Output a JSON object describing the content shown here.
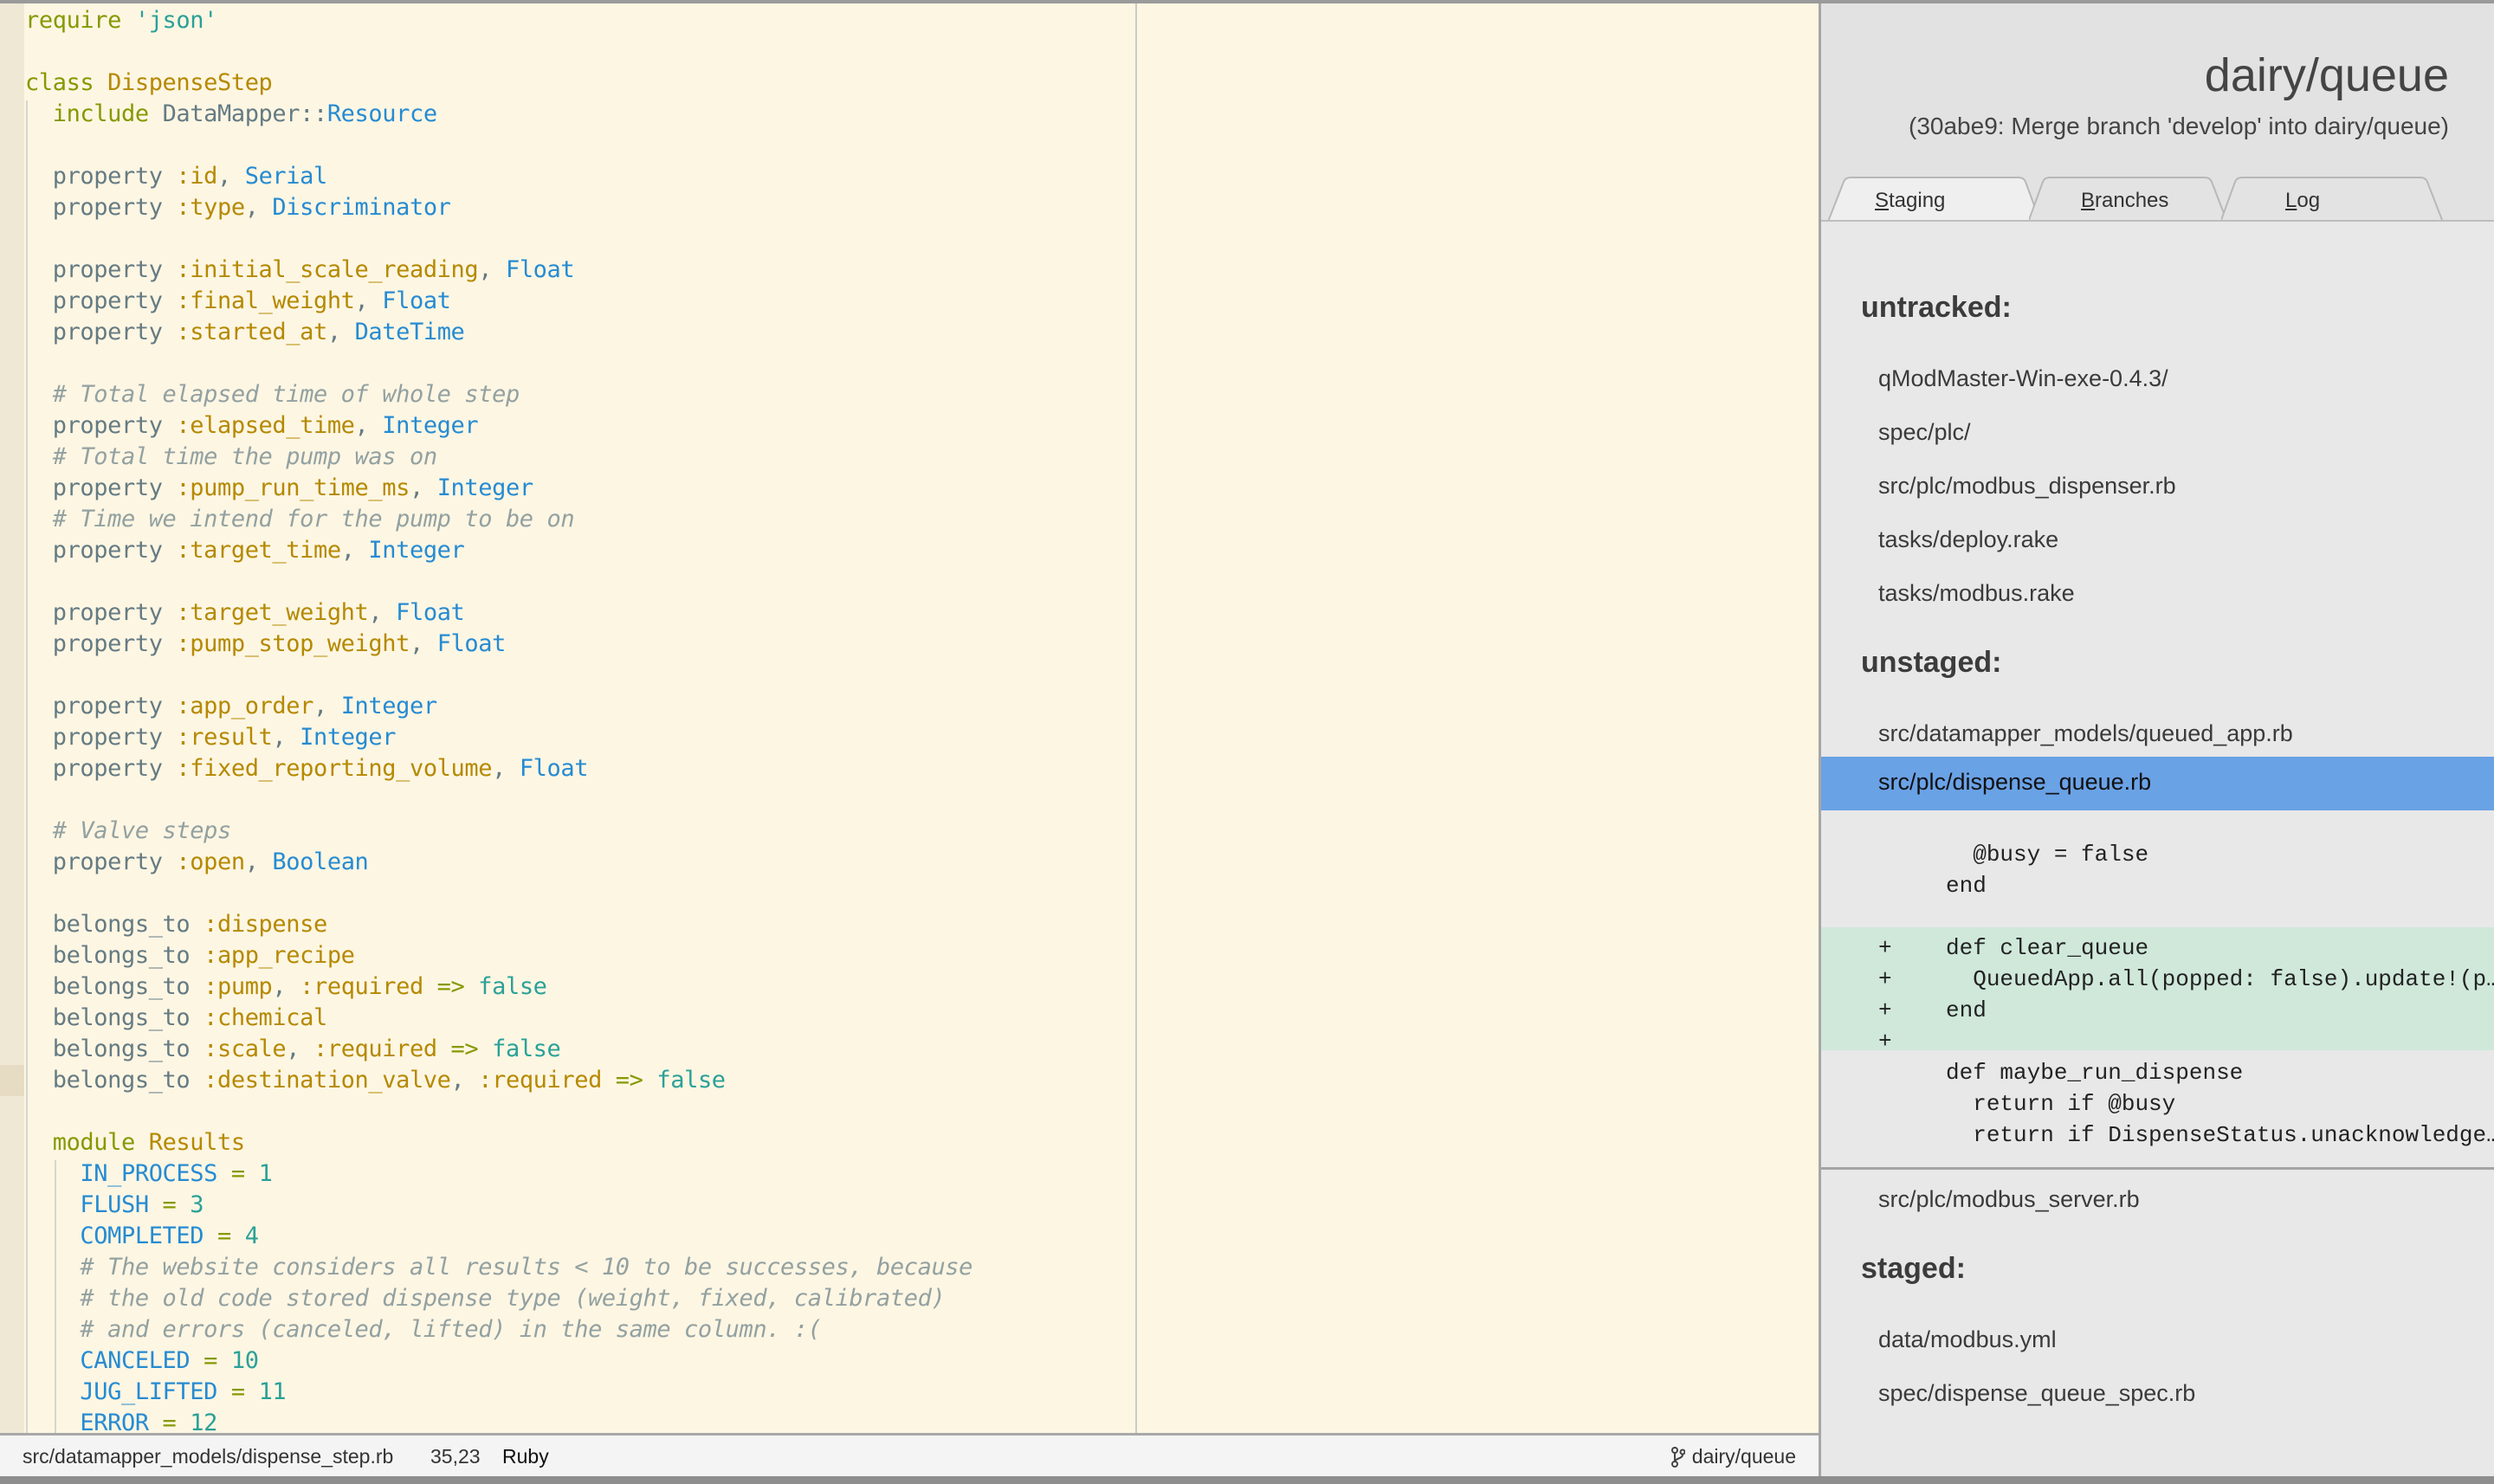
{
  "editor": {
    "lines": [
      [
        [
          "kw",
          "require "
        ],
        [
          "str",
          "'json'"
        ]
      ],
      [],
      [
        [
          "kw",
          "class "
        ],
        [
          "cls",
          "DispenseStep"
        ]
      ],
      [
        [
          "",
          "  "
        ],
        [
          "kw",
          "include "
        ],
        [
          "",
          "DataMapper::"
        ],
        [
          "const",
          "Resource"
        ]
      ],
      [],
      [
        [
          "",
          "  property "
        ],
        [
          "sym",
          ":id"
        ],
        [
          "",
          ", "
        ],
        [
          "const",
          "Serial"
        ]
      ],
      [
        [
          "",
          "  property "
        ],
        [
          "sym",
          ":type"
        ],
        [
          "",
          ", "
        ],
        [
          "const",
          "Discriminator"
        ]
      ],
      [],
      [
        [
          "",
          "  property "
        ],
        [
          "sym",
          ":initial_scale_reading"
        ],
        [
          "",
          ", "
        ],
        [
          "const",
          "Float"
        ]
      ],
      [
        [
          "",
          "  property "
        ],
        [
          "sym",
          ":final_weight"
        ],
        [
          "",
          ", "
        ],
        [
          "const",
          "Float"
        ]
      ],
      [
        [
          "",
          "  property "
        ],
        [
          "sym",
          ":started_at"
        ],
        [
          "",
          ", "
        ],
        [
          "const",
          "DateTime"
        ]
      ],
      [],
      [
        [
          "",
          "  "
        ],
        [
          "cm",
          "# Total elapsed time of whole step"
        ]
      ],
      [
        [
          "",
          "  property "
        ],
        [
          "sym",
          ":elapsed_time"
        ],
        [
          "",
          ", "
        ],
        [
          "const",
          "Integer"
        ]
      ],
      [
        [
          "",
          "  "
        ],
        [
          "cm",
          "# Total time the pump was on"
        ]
      ],
      [
        [
          "",
          "  property "
        ],
        [
          "sym",
          ":pump_run_time_ms"
        ],
        [
          "",
          ", "
        ],
        [
          "const",
          "Integer"
        ]
      ],
      [
        [
          "",
          "  "
        ],
        [
          "cm",
          "# Time we intend for the pump to be on"
        ]
      ],
      [
        [
          "",
          "  property "
        ],
        [
          "sym",
          ":target_time"
        ],
        [
          "",
          ", "
        ],
        [
          "const",
          "Integer"
        ]
      ],
      [],
      [
        [
          "",
          "  property "
        ],
        [
          "sym",
          ":target_weight"
        ],
        [
          "",
          ", "
        ],
        [
          "const",
          "Float"
        ]
      ],
      [
        [
          "",
          "  property "
        ],
        [
          "sym",
          ":pump_stop_weight"
        ],
        [
          "",
          ", "
        ],
        [
          "const",
          "Float"
        ]
      ],
      [],
      [
        [
          "",
          "  property "
        ],
        [
          "sym",
          ":app_order"
        ],
        [
          "",
          ", "
        ],
        [
          "const",
          "Integer"
        ]
      ],
      [
        [
          "",
          "  property "
        ],
        [
          "sym",
          ":result"
        ],
        [
          "",
          ", "
        ],
        [
          "const",
          "Integer"
        ]
      ],
      [
        [
          "",
          "  property "
        ],
        [
          "sym",
          ":fixed_reporting_volume"
        ],
        [
          "",
          ", "
        ],
        [
          "const",
          "Float"
        ]
      ],
      [],
      [
        [
          "",
          "  "
        ],
        [
          "cm",
          "# Valve steps"
        ]
      ],
      [
        [
          "",
          "  property "
        ],
        [
          "sym",
          ":open"
        ],
        [
          "",
          ", "
        ],
        [
          "const",
          "Boolean"
        ]
      ],
      [],
      [
        [
          "",
          "  belongs_to "
        ],
        [
          "sym",
          ":dispense"
        ]
      ],
      [
        [
          "",
          "  belongs_to "
        ],
        [
          "sym",
          ":app_recipe"
        ]
      ],
      [
        [
          "",
          "  belongs_to "
        ],
        [
          "sym",
          ":pump"
        ],
        [
          "",
          ", "
        ],
        [
          "sym",
          ":required"
        ],
        [
          "op",
          " => "
        ],
        [
          "lit",
          "false"
        ]
      ],
      [
        [
          "",
          "  belongs_to "
        ],
        [
          "sym",
          ":chemical"
        ]
      ],
      [
        [
          "",
          "  belongs_to "
        ],
        [
          "sym",
          ":scale"
        ],
        [
          "",
          ", "
        ],
        [
          "sym",
          ":required"
        ],
        [
          "op",
          " => "
        ],
        [
          "lit",
          "false"
        ]
      ],
      [
        [
          "",
          "  belongs_to "
        ],
        [
          "sym",
          ":destination_valve"
        ],
        [
          "",
          ", "
        ],
        [
          "sym",
          ":required"
        ],
        [
          "op",
          " => "
        ],
        [
          "lit",
          "false"
        ]
      ],
      [],
      [
        [
          "",
          "  "
        ],
        [
          "kw",
          "module "
        ],
        [
          "cls",
          "Results"
        ]
      ],
      [
        [
          "",
          "    "
        ],
        [
          "const",
          "IN_PROCESS"
        ],
        [
          "op",
          " = "
        ],
        [
          "num",
          "1"
        ]
      ],
      [
        [
          "",
          "    "
        ],
        [
          "const",
          "FLUSH"
        ],
        [
          "op",
          " = "
        ],
        [
          "num",
          "3"
        ]
      ],
      [
        [
          "",
          "    "
        ],
        [
          "const",
          "COMPLETED"
        ],
        [
          "op",
          " = "
        ],
        [
          "num",
          "4"
        ]
      ],
      [
        [
          "",
          "    "
        ],
        [
          "cm",
          "# The website considers all results < 10 to be successes, because"
        ]
      ],
      [
        [
          "",
          "    "
        ],
        [
          "cm",
          "# the old code stored dispense type (weight, fixed, calibrated)"
        ]
      ],
      [
        [
          "",
          "    "
        ],
        [
          "cm",
          "# and errors (canceled, lifted) in the same column. :("
        ]
      ],
      [
        [
          "",
          "    "
        ],
        [
          "const",
          "CANCELED"
        ],
        [
          "op",
          " = "
        ],
        [
          "num",
          "10"
        ]
      ],
      [
        [
          "",
          "    "
        ],
        [
          "const",
          "JUG_LIFTED"
        ],
        [
          "op",
          " = "
        ],
        [
          "num",
          "11"
        ]
      ],
      [
        [
          "",
          "    "
        ],
        [
          "const",
          "ERROR"
        ],
        [
          "op",
          " = "
        ],
        [
          "num",
          "12"
        ]
      ]
    ],
    "current_line": 35
  },
  "status": {
    "file_path": "src/datamapper_models/dispense_step.rb",
    "cursor_position": "35,23",
    "language": "Ruby",
    "branch": "dairy/queue",
    "branch_icon": "git-branch-icon"
  },
  "side": {
    "title": "dairy/queue",
    "subtitle": "(30abe9: Merge branch 'develop' into dairy/queue)",
    "tabs": [
      {
        "accel": "S",
        "rest": "taging",
        "active": true
      },
      {
        "accel": "B",
        "rest": "ranches",
        "active": false
      },
      {
        "accel": "L",
        "rest": "og",
        "active": false
      }
    ],
    "untracked_label": "untracked:",
    "untracked": [
      "qModMaster-Win-exe-0.4.3/",
      "spec/plc/",
      "src/plc/modbus_dispenser.rb",
      "tasks/deploy.rake",
      "tasks/modbus.rake"
    ],
    "unstaged_label": "unstaged:",
    "unstaged": [
      "src/datamapper_models/queued_app.rb",
      "src/plc/dispense_queue.rb",
      "src/plc/modbus_server.rb"
    ],
    "selected_file": "src/plc/dispense_queue.rb",
    "diff_lines": [
      {
        "prefix": " ",
        "text": "    @busy = false",
        "added": false
      },
      {
        "prefix": " ",
        "text": "  end",
        "added": false
      },
      {
        "prefix": " ",
        "text": "",
        "added": false
      },
      {
        "prefix": "+",
        "text": "  def clear_queue",
        "added": true
      },
      {
        "prefix": "+",
        "text": "    QueuedApp.all(popped: false).update!(p…",
        "added": true
      },
      {
        "prefix": "+",
        "text": "  end",
        "added": true
      },
      {
        "prefix": "+",
        "text": "",
        "added": true
      },
      {
        "prefix": " ",
        "text": "  def maybe_run_dispense",
        "added": false
      },
      {
        "prefix": " ",
        "text": "    return if @busy",
        "added": false
      },
      {
        "prefix": " ",
        "text": "    return if DispenseStatus.unacknowledge…",
        "added": false
      }
    ],
    "staged_label": "staged:",
    "staged": [
      "data/modbus.yml",
      "spec/dispense_queue_spec.rb"
    ]
  },
  "colors": {
    "editor_bg": "#fdf6e3",
    "selection": "#6aa2e6",
    "diff_added": "#cfe8da",
    "panel_bg": "#e8e8e8"
  }
}
